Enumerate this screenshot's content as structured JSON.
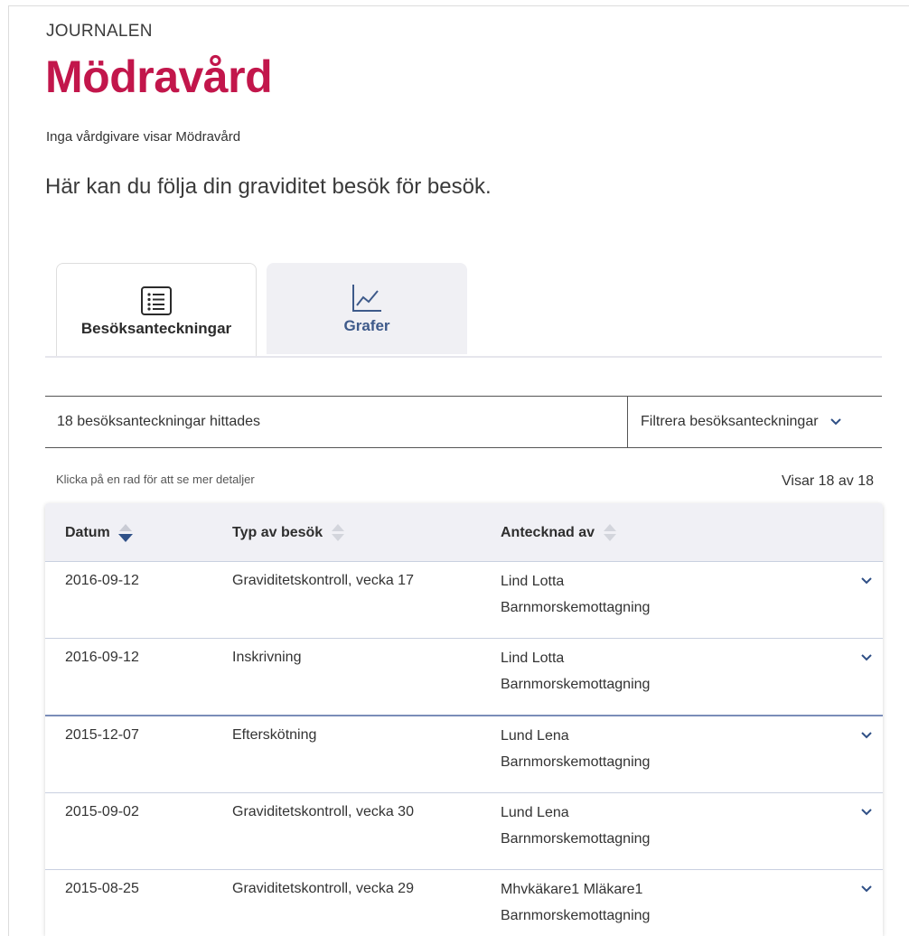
{
  "header": {
    "overline": "JOURNALEN",
    "title": "Mödravård",
    "provider_note": "Inga vårdgivare visar Mödravård",
    "lead": "Här kan du följa din graviditet besök för besök."
  },
  "tabs": [
    {
      "label": "Besöksanteckningar",
      "icon": "list-icon",
      "active": true
    },
    {
      "label": "Grafer",
      "icon": "line-chart-icon",
      "active": false
    }
  ],
  "results": {
    "count_text": "18 besöksanteckningar hittades",
    "filter_label": "Filtrera besöksanteckningar",
    "hint": "Klicka på en rad för att se mer detaljer",
    "showing": "Visar 18 av 18"
  },
  "table": {
    "columns": [
      "Datum",
      "Typ av besök",
      "Antecknad av"
    ],
    "rows": [
      {
        "date": "2016-09-12",
        "type": "Graviditetskontroll, vecka 17",
        "author": "Lind Lotta",
        "unit": "Barnmorskemottagning"
      },
      {
        "date": "2016-09-12",
        "type": "Inskrivning",
        "author": "Lind Lotta",
        "unit": "Barnmorskemottagning"
      },
      {
        "date": "2015-12-07",
        "type": "Efterskötning",
        "author": "Lund Lena",
        "unit": "Barnmorskemottagning"
      },
      {
        "date": "2015-09-02",
        "type": "Graviditetskontroll, vecka 30",
        "author": "Lund Lena",
        "unit": "Barnmorskemottagning"
      },
      {
        "date": "2015-08-25",
        "type": "Graviditetskontroll, vecka 29",
        "author": "Mhvkäkare1 Mläkare1",
        "unit": "Barnmorskemottagning"
      }
    ]
  },
  "colors": {
    "brand": "#c2164b",
    "tab_inactive_text": "#3e5a8a",
    "sort_active": "#3a5a8c"
  }
}
